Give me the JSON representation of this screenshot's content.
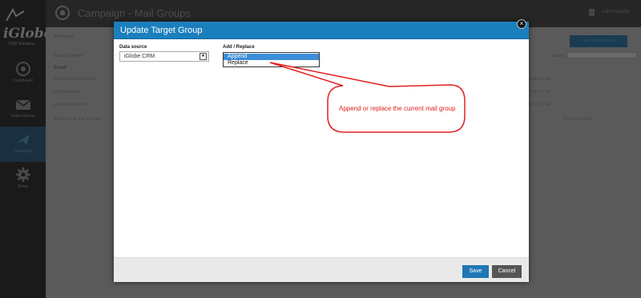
{
  "app": {
    "logo_text": "iGlobe",
    "logo_subtext": "CRM Solutions",
    "page_title": "Campaign - Mail Groups",
    "user_label": "Administrator"
  },
  "sidebar": {
    "items": [
      {
        "label": "Dashboard",
        "icon": "dashboard-icon"
      },
      {
        "label": "Subscriptions",
        "icon": "mail-icon"
      },
      {
        "label": "Campaign",
        "icon": "campaign-icon"
      },
      {
        "label": "Setup",
        "icon": "gear-icon"
      }
    ]
  },
  "background": {
    "breadcrumb": "Mail Group",
    "new_button": "New Target Group",
    "show_entries": "Show 10 entries",
    "search_label": "Search:",
    "table_header": "Email",
    "rows": [
      {
        "email": "test@iglobesolutions.dk",
        "date": "15-10-2013 11:44"
      },
      {
        "email": "info@iglobe.dk",
        "date": "15-10-2013 11:44"
      },
      {
        "email": "support@iglobe.dk",
        "date": "15-10-2013 11:44"
      }
    ],
    "footer": "Showing 1 to 3 of 3 entries",
    "pager": "Previous    1    Next"
  },
  "modal": {
    "title": "Update Target Group",
    "close_glyph": "×",
    "data_source_label": "Data source",
    "data_source_value": "iGlobe CRM",
    "add_replace_label": "Add / Replace",
    "options": [
      "Append",
      "Replace"
    ],
    "selected_option": "Append",
    "save_label": "Save",
    "cancel_label": "Cancel"
  },
  "annotation": {
    "text": "Append or replace the current mail group",
    "color": "#e02020"
  },
  "colors": {
    "header_blue": "#1b7fbe",
    "save_blue": "#1f77b4",
    "cancel_gray": "#555555",
    "selection_blue": "#3c8ed8"
  }
}
